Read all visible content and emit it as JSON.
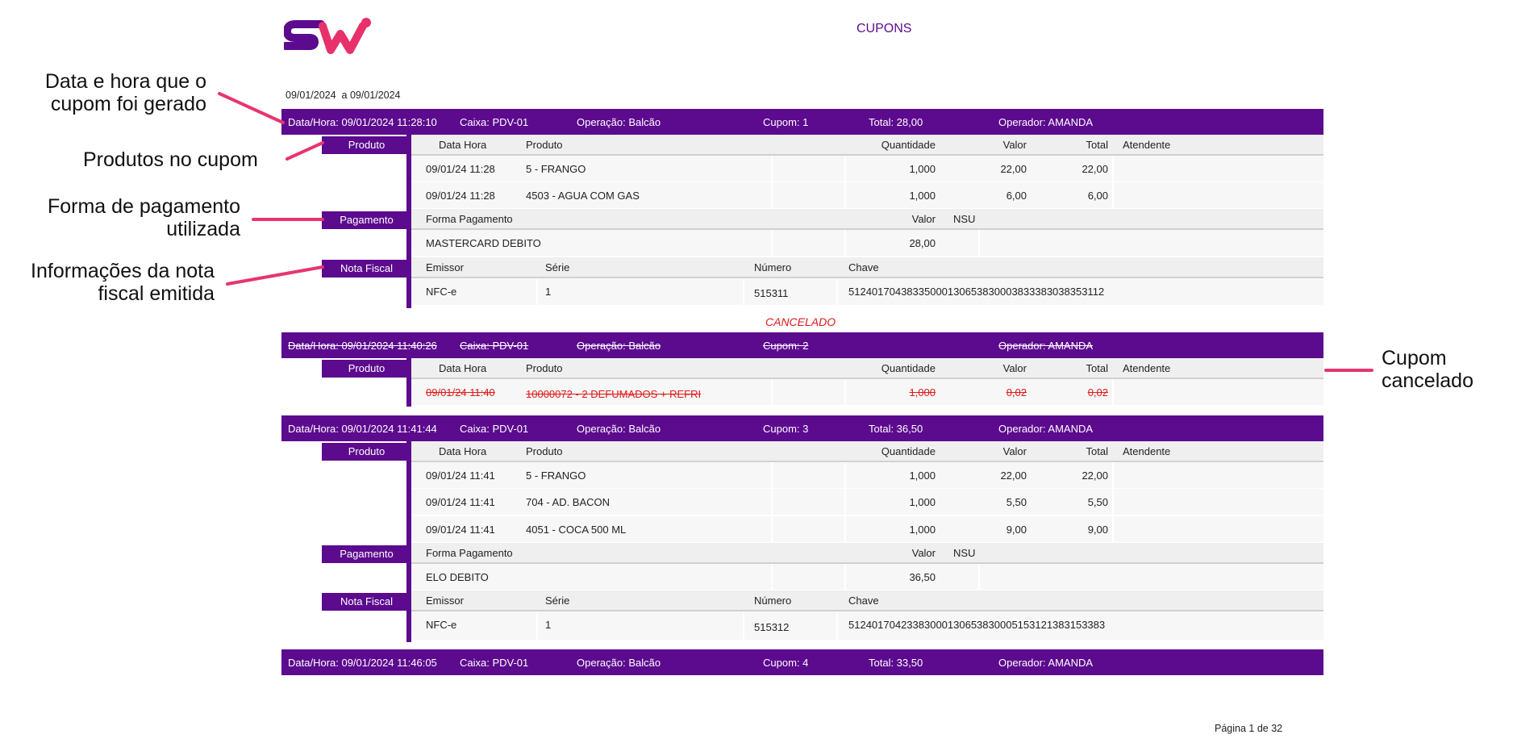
{
  "header": {
    "title": "CUPONS",
    "date_from": "09/01/2024",
    "date_sep": "a",
    "date_to": "09/01/2024"
  },
  "annotations": {
    "a1_line1": "Data e hora que o",
    "a1_line2": "cupom foi gerado",
    "a2_bold": "Produtos",
    "a2_rest": "no cupom",
    "a3_line1": "Forma de pagamento",
    "a3_line2": "utilizada",
    "a4_l1_a": "Informações da",
    "a4_l1_b": "nota",
    "a4_l2_a": "fiscal",
    "a4_l2_b": "emitida",
    "a5_line1": "Cupom",
    "a5_line2": "cancelado"
  },
  "labels": {
    "produto": "Produto",
    "pagamento": "Pagamento",
    "nota_fiscal": "Nota Fiscal",
    "cancelado": "CANCELADO"
  },
  "columns": {
    "produtos": [
      "Data Hora",
      "Produto",
      "Quantidade",
      "Valor",
      "Total",
      "Atendente"
    ],
    "pagamento": [
      "Forma Pagamento",
      "Valor",
      "NSU"
    ],
    "nota": [
      "Emissor",
      "Série",
      "Número",
      "Chave"
    ]
  },
  "cupom1": {
    "bar": [
      "Data/Hora: 09/01/2024 11:28:10",
      "Caixa: PDV-01",
      "Operação: Balcão",
      "Cupom: 1",
      "Total: 28,00",
      "Operador: AMANDA"
    ],
    "produtos": [
      [
        "09/01/24 11:28",
        "5 - FRANGO",
        "1,000",
        "22,00",
        "22,00"
      ],
      [
        "09/01/24 11:28",
        "4503 - AGUA COM GAS",
        "1,000",
        "6,00",
        "6,00"
      ]
    ],
    "pagamento": [
      "MASTERCARD DEBITO",
      "28,00"
    ],
    "nota": [
      "NFC-e",
      "1",
      "515311",
      "51240170438335000130653830003833383038353112"
    ]
  },
  "cupom2": {
    "bar": [
      "Data/Hora: 09/01/2024 11:40:26",
      "Caixa: PDV-01",
      "Operação: Balcão",
      "Cupom: 2",
      "Operador: AMANDA"
    ],
    "produtos": [
      [
        "09/01/24 11:40",
        "10000072 - 2 DEFUMADOS + REFRI",
        "1,000",
        "0,02",
        "0,02"
      ]
    ]
  },
  "cupom3": {
    "bar": [
      "Data/Hora: 09/01/2024 11:41:44",
      "Caixa: PDV-01",
      "Operação: Balcão",
      "Cupom: 3",
      "Total: 36,50",
      "Operador: AMANDA"
    ],
    "produtos": [
      [
        "09/01/24 11:41",
        "5 - FRANGO",
        "1,000",
        "22,00",
        "22,00"
      ],
      [
        "09/01/24 11:41",
        "704 - AD. BACON",
        "1,000",
        "5,50",
        "5,50"
      ],
      [
        "09/01/24 11:41",
        "4051 - COCA 500 ML",
        "1,000",
        "9,00",
        "9,00"
      ]
    ],
    "pagamento": [
      "ELO DEBITO",
      "36,50"
    ],
    "nota": [
      "NFC-e",
      "1",
      "515312",
      "51240170423383000130653830005153121383153383"
    ]
  },
  "cupom4": {
    "bar": [
      "Data/Hora: 09/01/2024 11:46:05",
      "Caixa: PDV-01",
      "Operação: Balcão",
      "Cupom: 4",
      "Total: 33,50",
      "Operador: AMANDA"
    ]
  },
  "footer": {
    "page": "Página 1 de 32"
  },
  "colors": {
    "brand_purple": "#5c0a8e",
    "logo_pink": "#e8316b",
    "annotation_pink": "#e8356d",
    "cancel_red": "#e01818"
  }
}
